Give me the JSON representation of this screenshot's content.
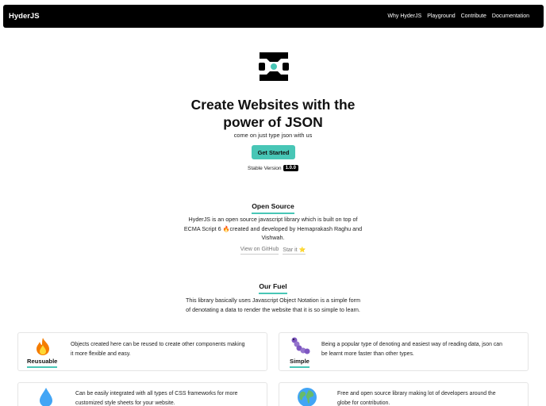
{
  "navbar": {
    "brand": "HyderJS",
    "links": [
      "Why HyderJS",
      "Playground",
      "Contribute",
      "Documentation"
    ]
  },
  "hero": {
    "logo_icon": "curly-braces-logo-icon",
    "title_line1": "Create Websites with the",
    "title_line2": "power of JSON",
    "subtitle": "come on just type json with us",
    "cta_label": "Get Started",
    "stable_label": "Stable Version",
    "version": "1.0.0"
  },
  "open_source": {
    "title": "Open Source",
    "line1": "HyderJS is an open source javascript library which is built on top of",
    "line2": "ECMA Script 6 🔥created and developed by Hemaprakash Raghu and",
    "line3": "Vishwah.",
    "github_link": "View on GitHub",
    "star_link": "Star it ⭐"
  },
  "fuel": {
    "title": "Our Fuel",
    "line1": "This library basically uses Javascript Object Notation is a simple form",
    "line2": "of denotating a data to render the website that it is so simple to learn."
  },
  "features": [
    {
      "icon": "fire-icon",
      "label": "Reusuable",
      "line1": "Objects created here can be reused to create other components making",
      "line2": "it more flexible and easy."
    },
    {
      "icon": "caterpillar-icon",
      "label": "Simple",
      "line1": "Being a popular type of denoting and easiest way of reading data, json can",
      "line2": "be learnt more faster than other types."
    },
    {
      "icon": "droplet-icon",
      "label": "",
      "line1": "Can be easily integrated with all types of CSS frameworks for more",
      "line2": "customized style sheets for your website."
    },
    {
      "icon": "globe-icon",
      "label": "",
      "line1": "Free and open source library making lot of developers around the",
      "line2": "globe for contribution."
    }
  ],
  "colors": {
    "accent": "#48c6b6",
    "navbar": "#000000"
  }
}
